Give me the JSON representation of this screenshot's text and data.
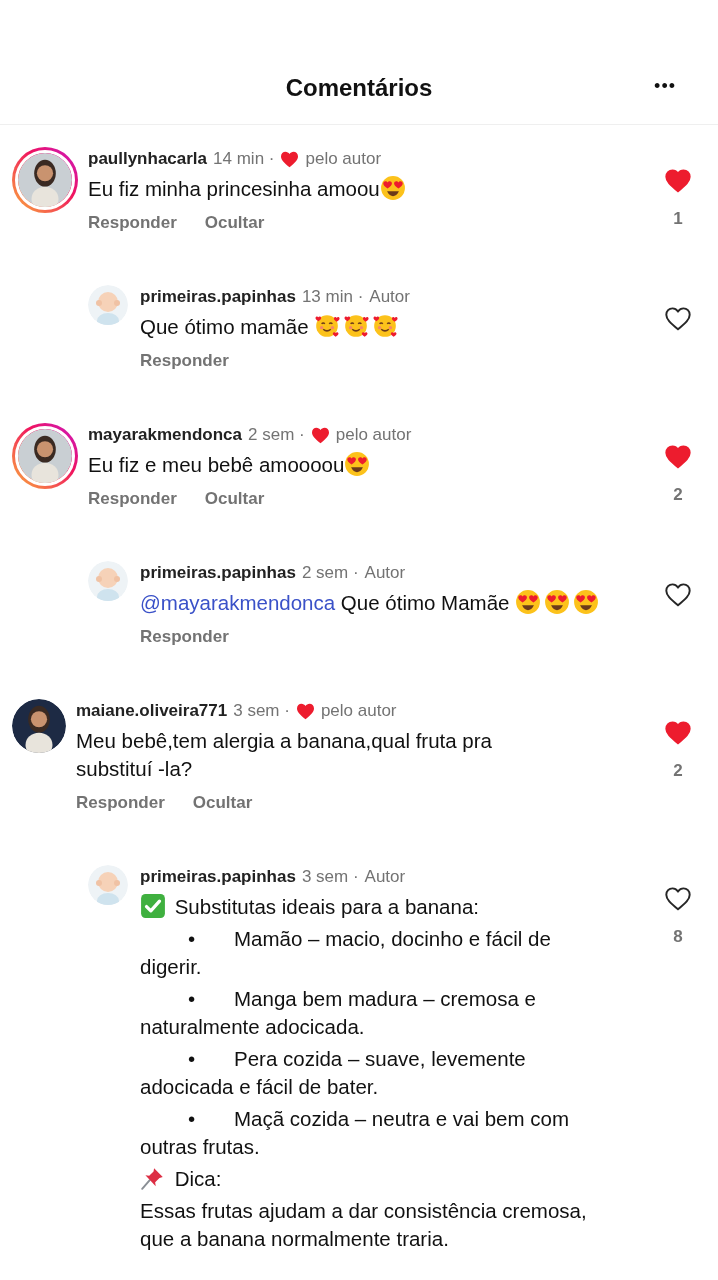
{
  "header": {
    "title": "Comentários",
    "more": "•••"
  },
  "comments": [
    {
      "username": "paullynhacarla",
      "time": "14 min ·",
      "author_liked": true,
      "author_liked_label": "pelo autor",
      "story_ring": true,
      "body": [
        {
          "parts": [
            {
              "kind": "text",
              "text": "Eu fiz minha princesinha amoou"
            },
            {
              "kind": "heart_eyes"
            }
          ]
        }
      ],
      "actions": [
        "Responder",
        "Ocultar"
      ],
      "liked": true,
      "likes": "1",
      "replies": [
        {
          "username": "primeiras.papinhas",
          "time": "13 min ·",
          "role": "Autor",
          "body": [
            {
              "parts": [
                {
                  "kind": "text",
                  "text": "Que ótimo mamãe "
                },
                {
                  "kind": "hearts_face"
                },
                {
                  "kind": "hearts_face"
                },
                {
                  "kind": "hearts_face"
                }
              ]
            }
          ],
          "actions": [
            "Responder"
          ],
          "liked": false
        }
      ]
    },
    {
      "username": "mayarakmendonca",
      "time": "2 sem ·",
      "author_liked": true,
      "author_liked_label": "pelo autor",
      "story_ring": true,
      "body": [
        {
          "parts": [
            {
              "kind": "text",
              "text": "Eu fiz e meu bebê amoooou"
            },
            {
              "kind": "heart_eyes"
            }
          ]
        }
      ],
      "actions": [
        "Responder",
        "Ocultar"
      ],
      "liked": true,
      "likes": "2",
      "replies": [
        {
          "username": "primeiras.papinhas",
          "time": "2 sem ·",
          "role": "Autor",
          "body": [
            {
              "parts": [
                {
                  "kind": "mention",
                  "text": "@mayarakmendonca"
                },
                {
                  "kind": "text",
                  "text": " Que ótimo Mamãe "
                },
                {
                  "kind": "heart_eyes"
                },
                {
                  "kind": "heart_eyes"
                },
                {
                  "kind": "heart_eyes"
                }
              ]
            }
          ],
          "actions": [
            "Responder"
          ],
          "liked": false
        }
      ]
    },
    {
      "username": "maiane.oliveira771",
      "time": "3 sem ·",
      "author_liked": true,
      "author_liked_label": "pelo autor",
      "story_ring": false,
      "body": [
        {
          "parts": [
            {
              "kind": "text",
              "text": "Meu bebê,tem alergia a banana,qual fruta pra substituí -la?"
            }
          ]
        }
      ],
      "actions": [
        "Responder",
        "Ocultar"
      ],
      "liked": true,
      "likes": "2",
      "replies": [
        {
          "username": "primeiras.papinhas",
          "time": "3 sem ·",
          "role": "Autor",
          "body": [
            {
              "parts": [
                {
                  "kind": "check"
                },
                {
                  "kind": "text",
                  "text": " Substitutas ideais para a banana:"
                }
              ]
            },
            {
              "parts": [
                {
                  "kind": "bullet",
                  "text": "•"
                },
                {
                  "kind": "text",
                  "text": "Mamão – macio, docinho e fácil de digerir."
                }
              ]
            },
            {
              "parts": [
                {
                  "kind": "bullet",
                  "text": "•"
                },
                {
                  "kind": "text",
                  "text": "Manga bem madura – cremosa e naturalmente adocicada."
                }
              ]
            },
            {
              "parts": [
                {
                  "kind": "bullet",
                  "text": "•"
                },
                {
                  "kind": "text",
                  "text": "Pera cozida – suave, levemente adocicada e fácil de bater."
                }
              ]
            },
            {
              "parts": [
                {
                  "kind": "bullet",
                  "text": "•"
                },
                {
                  "kind": "text",
                  "text": "Maçã cozida – neutra e vai bem com outras frutas."
                }
              ]
            },
            {
              "parts": [
                {
                  "kind": "pin"
                },
                {
                  "kind": "text",
                  "text": " Dica:"
                }
              ]
            },
            {
              "parts": [
                {
                  "kind": "text",
                  "text": "Essas frutas ajudam a dar consistência cremosa, que a banana normalmente traria."
                }
              ]
            }
          ],
          "liked": false,
          "likes": "8"
        }
      ]
    }
  ]
}
